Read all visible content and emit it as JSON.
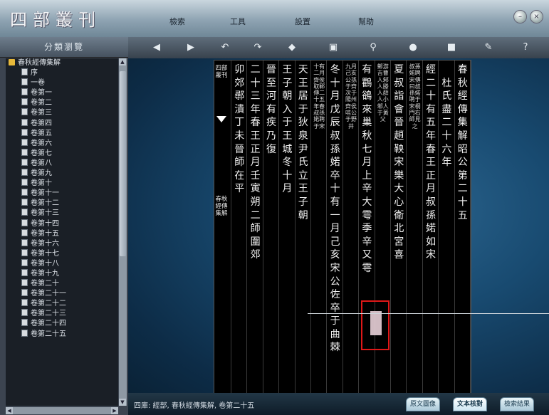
{
  "app": {
    "logo": "四部叢刊",
    "menu": [
      "檢索",
      "工具",
      "設置",
      "幫助"
    ],
    "window_controls": [
      "minimize",
      "close"
    ]
  },
  "sidebar": {
    "header": "分類瀏覽",
    "root": "春秋經傳集解",
    "items": [
      "序",
      "一卷",
      "卷第一",
      "卷第二",
      "卷第三",
      "卷第四",
      "卷第五",
      "卷第六",
      "卷第七",
      "卷第八",
      "卷第九",
      "卷第十",
      "卷第十一",
      "卷第十二",
      "卷第十三",
      "卷第十四",
      "卷第十五",
      "卷第十六",
      "卷第十七",
      "卷第十八",
      "卷第十九",
      "卷第二十",
      "卷第二十一",
      "卷第二十二",
      "卷第二十三",
      "卷第二十四",
      "卷第二十五"
    ]
  },
  "toolbar": {
    "tools": [
      "back-icon",
      "forward-icon",
      "undo-icon",
      "redo-icon",
      "eraser-icon",
      "copy-icon",
      "search-icon",
      "pin-icon",
      "book-icon",
      "note-icon",
      "help-icon"
    ]
  },
  "page": {
    "side_label": "四部叢刊",
    "side_title": "春秋經傳集解",
    "columns": [
      {
        "kind": "large",
        "text": "春秋經傳集解昭公第二十五"
      },
      {
        "kind": "large",
        "text": "　　　　　　　杜氏　　盡二十六年"
      },
      {
        "kind": "large",
        "text": "經二十有五年春王正月叔孫婼如宋"
      },
      {
        "kind": "small",
        "text": "叔孫婼聘宋傳曰叔孫婼聘于宋桐門右師見之"
      },
      {
        "kind": "large",
        "text": "夏叔詣會晉趙鞅宋樂大心衛北宮喜"
      },
      {
        "kind": "small",
        "text": "鄭游吉曹人邾人滕人薛人小邾人于黃父"
      },
      {
        "kind": "large",
        "text": "有鸜鵒來巢秋七月上辛大雩季辛又雩"
      },
      {
        "kind": "small",
        "text": "九月己亥公孫于齊次于陽州齊侯唁公于野井"
      },
      {
        "kind": "large",
        "text": "冬十月戊辰叔孫婼卒十有一月己亥宋公佐卒于曲棘"
      },
      {
        "kind": "small",
        "text": "十有二月齊侯取鄆傳二十五年春叔孫婼聘于宋"
      },
      {
        "kind": "large",
        "text": "天王居于狄泉尹氏立王子朝"
      },
      {
        "kind": "large",
        "text": "王子朝入于王城冬十月"
      },
      {
        "kind": "large",
        "text": "晉至河有疾乃復"
      },
      {
        "kind": "large",
        "text": "二十三年春王正月壬寅朔二師圍郊"
      },
      {
        "kind": "large",
        "text": "卯郊鄩潰丁未晉師在平"
      }
    ]
  },
  "status": {
    "text": "四庫: 經部, 春秋經傳集解, 卷第二十五",
    "tabs": [
      "原文圖像",
      "文本核對",
      "檢索結果"
    ]
  }
}
